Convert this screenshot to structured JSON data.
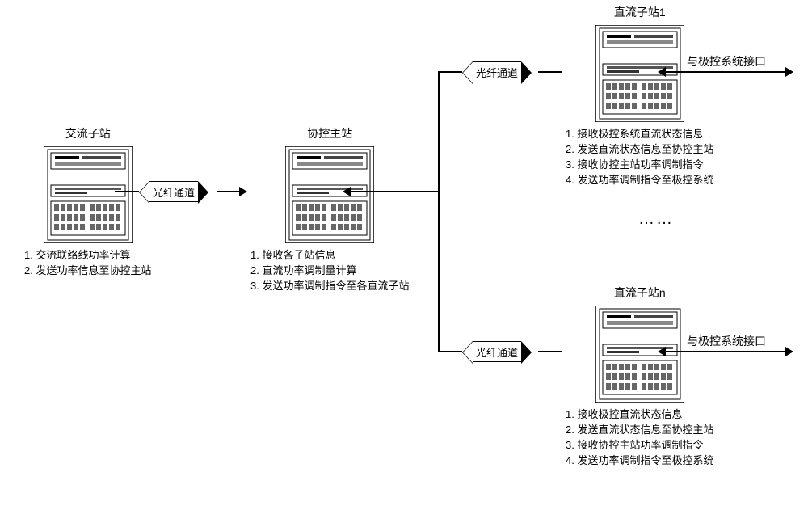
{
  "nodes": {
    "ac": {
      "title": "交流子站",
      "desc": [
        "1. 交流联络线功率计算",
        "2. 发送功率信息至协控主站"
      ]
    },
    "master": {
      "title": "协控主站",
      "desc": [
        "1. 接收各子站信息",
        "2. 直流功率调制量计算",
        "3. 发送功率调制指令至各直流子站"
      ]
    },
    "dc1": {
      "title": "直流子站1",
      "desc": [
        "1. 接收极控系统直流状态信息",
        "2. 发送直流状态信息至协控主站",
        "3. 接收协控主站功率调制指令",
        "4. 发送功率调制指令至极控系统"
      ]
    },
    "dcn": {
      "title": "直流子站n",
      "desc": [
        "1. 接收极控直流状态信息",
        "2. 发送直流状态信息至协控主站",
        "3. 接收协控主站功率调制指令",
        "4. 发送功率调制指令至极控系统"
      ]
    }
  },
  "labels": {
    "fiber": "光纤通道",
    "iface": "与极控系统接口",
    "dots": "……"
  }
}
